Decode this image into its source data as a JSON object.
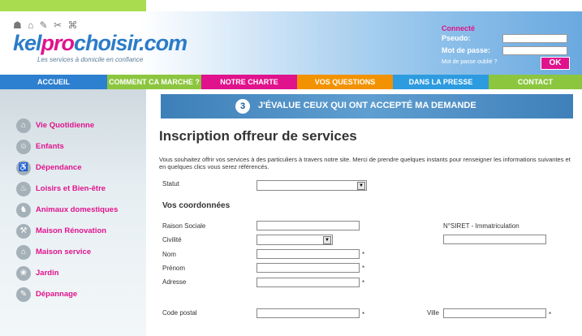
{
  "logo": {
    "icons": "☗ ⌂ ✎ ✂ ⌘",
    "part1": "kel",
    "part2": "pro",
    "part3": "choisir.com",
    "tagline": "Les services à domicile en confiance"
  },
  "login": {
    "title": "Connecté",
    "pseudo_label": "Pseudo:",
    "password_label": "Mot de passe:",
    "forgot": "Mot de passe oublié ?",
    "ok": "OK"
  },
  "nav": [
    {
      "label": "ACCUEIL",
      "color": "#2d7fd0"
    },
    {
      "label": "COMMENT CA MARCHE ?",
      "color": "#8cc63f"
    },
    {
      "label": "NOTRE CHARTE",
      "color": "#e0138c"
    },
    {
      "label": "VOS QUESTIONS",
      "color": "#f39200"
    },
    {
      "label": "DANS LA PRESSE",
      "color": "#2d9be0"
    },
    {
      "label": "CONTACT",
      "color": "#8cc63f"
    }
  ],
  "sidebar": {
    "items": [
      {
        "label": "Vie Quotidienne",
        "icon": "home-icon"
      },
      {
        "label": "Enfants",
        "icon": "child-icon"
      },
      {
        "label": "Dépendance",
        "icon": "care-icon"
      },
      {
        "label": "Loisirs et Bien-être",
        "icon": "leisure-icon"
      },
      {
        "label": "Animaux domestiques",
        "icon": "pet-icon"
      },
      {
        "label": "Maison Rénovation",
        "icon": "renovation-icon"
      },
      {
        "label": "Maison service",
        "icon": "house-icon"
      },
      {
        "label": "Jardin",
        "icon": "garden-icon"
      },
      {
        "label": "Dépannage",
        "icon": "repair-icon"
      }
    ]
  },
  "banner": {
    "number": "3",
    "text": "J'ÉVALUE CEUX QUI ONT ACCEPTÉ MA DEMANDE"
  },
  "form": {
    "title": "Inscription offreur de services",
    "intro": "Vous souhaitez offrir vos services à des particuliers à travers notre site. Merci de prendre quelques instants pour renseigner les informations suivantes et en quelques clics vous serez référencés.",
    "statut_label": "Statut",
    "section_title": "Vos coordonnées",
    "raison_label": "Raison Sociale",
    "siret_label": "N°SIRET - Immatriculation",
    "civilite_label": "Civilité",
    "nom_label": "Nom",
    "prenom_label": "Prénom",
    "adresse_label": "Adresse",
    "cp_label": "Code postal",
    "ville_label": "Ville",
    "required": "*"
  }
}
